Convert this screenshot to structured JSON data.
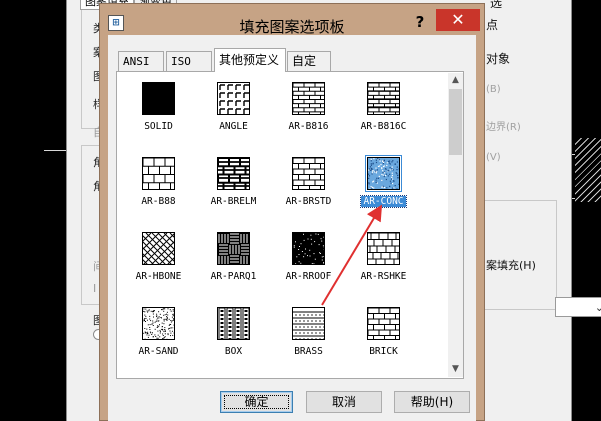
{
  "background": {
    "parent_tabs": [
      "图案填充",
      "渐变色"
    ],
    "right_items": [
      {
        "text": "选",
        "gray": false
      },
      {
        "text": "点",
        "gray": false
      },
      {
        "text": "对象",
        "gray": false
      },
      {
        "text": "(B)",
        "gray": true
      },
      {
        "text": "边界(R)",
        "gray": true
      },
      {
        "text": "(V)",
        "gray": true
      },
      {
        "text": "案填充(H)",
        "gray": false
      }
    ],
    "left_stubs": [
      "类",
      "案",
      "图",
      "样",
      "自",
      "角",
      "角",
      "间",
      "I",
      "图"
    ]
  },
  "dialog": {
    "title": "填充图案选项板",
    "help_glyph": "?",
    "close_glyph": "✕",
    "icon_text": "⊞",
    "tabs": [
      {
        "label": "ANSI",
        "active": false
      },
      {
        "label": "ISO",
        "active": false
      },
      {
        "label": "其他预定义",
        "active": true
      },
      {
        "label": "自定义",
        "active": false
      }
    ],
    "patterns": [
      {
        "name": "SOLID",
        "icon": "solid-pattern-icon"
      },
      {
        "name": "ANGLE",
        "icon": "angle-pattern-icon"
      },
      {
        "name": "AR-B816",
        "icon": "ar-b816-pattern-icon"
      },
      {
        "name": "AR-B816C",
        "icon": "ar-b816c-pattern-icon"
      },
      {
        "name": "AR-B88",
        "icon": "ar-b88-pattern-icon"
      },
      {
        "name": "AR-BRELM",
        "icon": "ar-brelm-pattern-icon"
      },
      {
        "name": "AR-BRSTD",
        "icon": "ar-brstd-pattern-icon"
      },
      {
        "name": "AR-CONC",
        "icon": "ar-conc-pattern-icon",
        "selected": true
      },
      {
        "name": "AR-HBONE",
        "icon": "ar-hbone-pattern-icon"
      },
      {
        "name": "AR-PARQ1",
        "icon": "ar-parq1-pattern-icon"
      },
      {
        "name": "AR-RROOF",
        "icon": "ar-rroof-pattern-icon"
      },
      {
        "name": "AR-RSHKE",
        "icon": "ar-rshke-pattern-icon"
      },
      {
        "name": "AR-SAND",
        "icon": "ar-sand-pattern-icon"
      },
      {
        "name": "BOX",
        "icon": "box-pattern-icon"
      },
      {
        "name": "BRASS",
        "icon": "brass-pattern-icon"
      },
      {
        "name": "BRICK",
        "icon": "brick-pattern-icon"
      }
    ],
    "buttons": {
      "ok": "确定",
      "cancel": "取消",
      "help": "帮助(H)"
    },
    "scroll": {
      "up": "▲",
      "down": "▼"
    }
  },
  "colors": {
    "title_bar": "#c6a385",
    "close_button": "#c9352a",
    "selection": "#3c8bd6",
    "annotation_arrow": "#e03030"
  }
}
